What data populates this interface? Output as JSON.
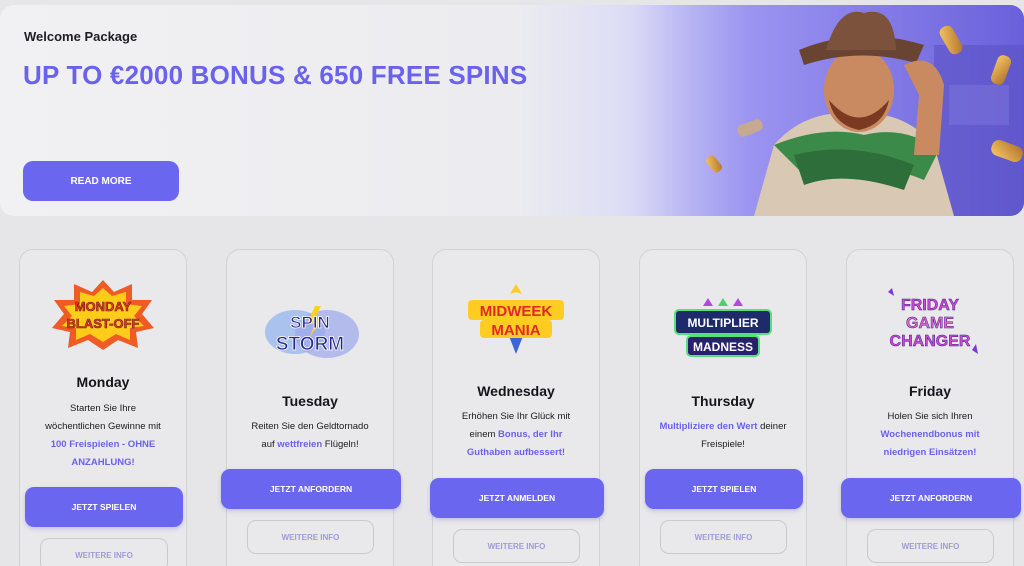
{
  "banner": {
    "eyebrow": "Welcome Package",
    "title": "UP TO €2000 BONUS & 650 FREE SPINS",
    "button": "READ MORE"
  },
  "cards": [
    {
      "logo": [
        "MONDAY",
        "BLAST-OFF"
      ],
      "day": "Monday",
      "desc_lines": [
        [
          {
            "t": "Starten Sie Ihre",
            "hl": false
          }
        ],
        [
          {
            "t": "wöchentlichen Gewinne mit",
            "hl": false
          }
        ],
        [
          {
            "t": "100 Freispielen - OHNE",
            "hl": true
          }
        ],
        [
          {
            "t": "ANZAHLUNG!",
            "hl": true
          }
        ]
      ],
      "button": "JETZT SPIELEN",
      "info": "WEITERE INFO"
    },
    {
      "logo": [
        "SPIN",
        "STORM"
      ],
      "day": "Tuesday",
      "desc_lines": [
        [
          {
            "t": "Reiten Sie den Geldtornado",
            "hl": false
          }
        ],
        [
          {
            "t": "auf ",
            "hl": false
          },
          {
            "t": "wettfreien",
            "hl": true
          },
          {
            "t": " Flügeln!",
            "hl": false
          }
        ]
      ],
      "button": "JETZT ANFORDERN",
      "info": "WEITERE INFO"
    },
    {
      "logo": [
        "MIDWEEK",
        "MANIA"
      ],
      "day": "Wednesday",
      "desc_lines": [
        [
          {
            "t": "Erhöhen Sie Ihr Glück mit",
            "hl": false
          }
        ],
        [
          {
            "t": "einem ",
            "hl": false
          },
          {
            "t": "Bonus, der Ihr",
            "hl": true
          }
        ],
        [
          {
            "t": "Guthaben aufbessert!",
            "hl": true
          }
        ]
      ],
      "button": "JETZT ANMELDEN",
      "info": "WEITERE INFO"
    },
    {
      "logo": [
        "MULTIPLIER",
        "MADNESS"
      ],
      "day": "Thursday",
      "desc_lines": [
        [
          {
            "t": "Multipliziere den Wert",
            "hl": true
          },
          {
            "t": " deiner",
            "hl": false
          }
        ],
        [
          {
            "t": "Freispiele!",
            "hl": false
          }
        ]
      ],
      "button": "JETZT SPIELEN",
      "info": "WEITERE INFO"
    },
    {
      "logo": [
        "FRIDAY",
        "GAME",
        "CHANGER"
      ],
      "day": "Friday",
      "desc_lines": [
        [
          {
            "t": "Holen Sie sich Ihren",
            "hl": false
          }
        ],
        [
          {
            "t": "Wochenendbonus mit",
            "hl": true
          }
        ],
        [
          {
            "t": "niedrigen Einsätzen!",
            "hl": true
          }
        ]
      ],
      "button": "JETZT ANFORDERN",
      "info": "WEITERE INFO"
    }
  ]
}
